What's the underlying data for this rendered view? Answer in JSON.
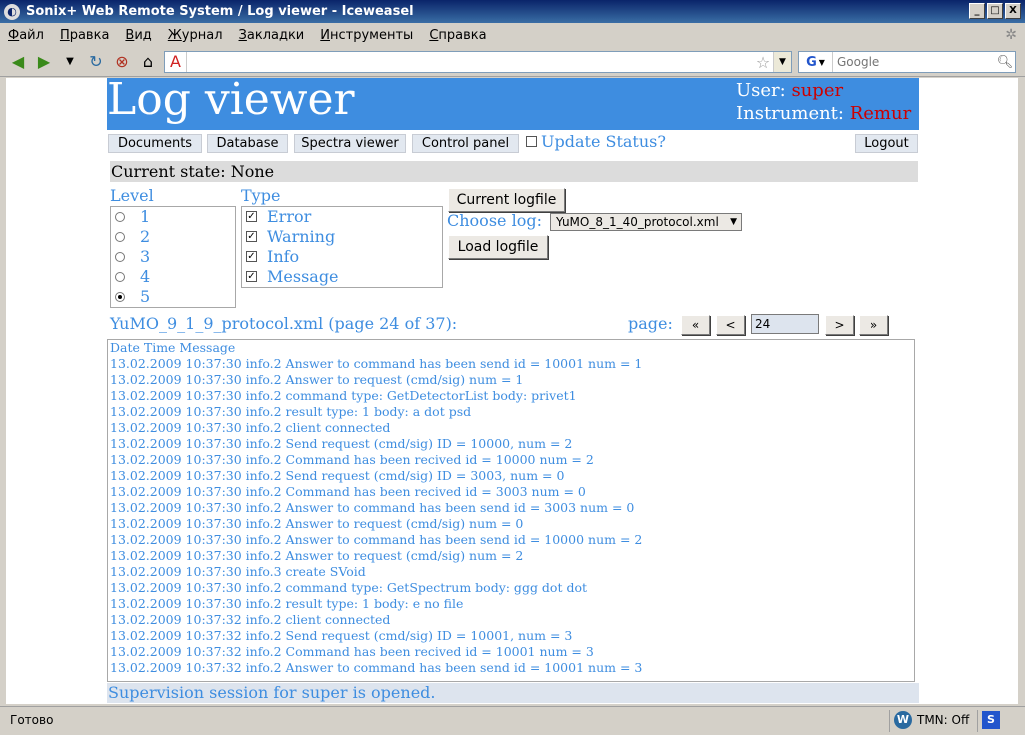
{
  "window": {
    "title": "Sonix+ Web Remote System / Log viewer - Iceweasel",
    "minimize": "_",
    "maximize": "□",
    "close": "X"
  },
  "menu": [
    "Файл",
    "Правка",
    "Вид",
    "Журнал",
    "Закладки",
    "Инструменты",
    "Справка"
  ],
  "navbar": {
    "url": "",
    "search_engine": "G",
    "search_placeholder": "Google"
  },
  "header": {
    "title": "Log viewer",
    "user_label": "User:",
    "user_value": "super",
    "instrument_label": "Instrument:",
    "instrument_value": "Remur"
  },
  "tabs": [
    "Documents",
    "Database",
    "Spectra viewer",
    "Control panel"
  ],
  "update_status": "Update Status?",
  "logout": "Logout",
  "state": "Current state: None",
  "level": {
    "label": "Level",
    "options": [
      "1",
      "2",
      "3",
      "4",
      "5"
    ],
    "selected": "5"
  },
  "type": {
    "label": "Type",
    "options": [
      "Error",
      "Warning",
      "Info",
      "Message"
    ]
  },
  "controls": {
    "current_logfile": "Current logfile",
    "choose_log_label": "Choose log:",
    "selected_log": "YuMO_8_1_40_protocol.xml",
    "load_logfile": "Load logfile"
  },
  "pager": {
    "file_title": "YuMO_9_1_9_protocol.xml (page 24 of 37):",
    "label": "page:",
    "first": "«",
    "prev": "<",
    "page": "24",
    "next": ">",
    "last": "»"
  },
  "log": {
    "header": "Date Time Message",
    "lines": [
      "13.02.2009 10:37:30 info.2 Answer to command has been send id = 10001 num = 1",
      "13.02.2009 10:37:30 info.2 Answer to request (cmd/sig) num = 1",
      "13.02.2009 10:37:30 info.2 command type: GetDetectorList body: privet1",
      "13.02.2009 10:37:30 info.2 result type: 1 body: a dot psd",
      "13.02.2009 10:37:30 info.2 client connected",
      "13.02.2009 10:37:30 info.2 Send request (cmd/sig) ID = 10000, num = 2",
      "13.02.2009 10:37:30 info.2 Command has been recived id = 10000 num = 2",
      "13.02.2009 10:37:30 info.2 Send request (cmd/sig) ID = 3003, num = 0",
      "13.02.2009 10:37:30 info.2 Command has been recived id = 3003 num = 0",
      "13.02.2009 10:37:30 info.2 Answer to command has been send id = 3003 num = 0",
      "13.02.2009 10:37:30 info.2 Answer to request (cmd/sig) num = 0",
      "13.02.2009 10:37:30 info.2 Answer to command has been send id = 10000 num = 2",
      "13.02.2009 10:37:30 info.2 Answer to request (cmd/sig) num = 2",
      "13.02.2009 10:37:30 info.3 create SVoid",
      "13.02.2009 10:37:30 info.2 command type: GetSpectrum body: ggg dot dot",
      "13.02.2009 10:37:30 info.2 result type: 1 body: e no file",
      "13.02.2009 10:37:32 info.2 client connected",
      "13.02.2009 10:37:32 info.2 Send request (cmd/sig) ID = 10001, num = 3",
      "13.02.2009 10:37:32 info.2 Command has been recived id = 10001 num = 3",
      "13.02.2009 10:37:32 info.2 Answer to command has been send id = 10001 num = 3"
    ]
  },
  "footer": "Supervision session for super is opened.",
  "statusbar": {
    "text": "Готово",
    "tmn": "TMN: Off"
  }
}
